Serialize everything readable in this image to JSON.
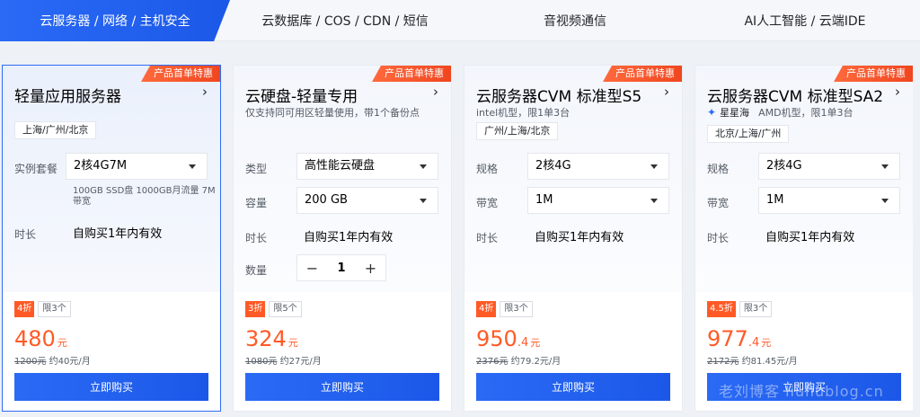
{
  "tabs": [
    {
      "label": "云服务器 / 网络 / 主机安全",
      "active": true
    },
    {
      "label": "云数据库 / COS / CDN / 短信",
      "active": false
    },
    {
      "label": "音视频通信",
      "active": false
    },
    {
      "label": "AI人工智能 / 云端IDE",
      "active": false
    }
  ],
  "colors": {
    "accent": "#1c58e8",
    "price": "#ff5a26",
    "ribbon": "#f0461f"
  },
  "cards": [
    {
      "ribbon": "产品首单特惠",
      "title": "轻量应用服务器",
      "arrow": "›",
      "region": "上海/广州/北京",
      "spec_label": "实例套餐",
      "spec_value": "2核4G7M",
      "spec_note": "100GB SSD盘 1000GB月流量 7M带宽",
      "duration_label": "时长",
      "duration_value": "自购买1年内有效",
      "discount": "4折",
      "limit": "限3个",
      "price_big": "480",
      "price_small": "",
      "price_unit": "元",
      "orig_price": "1200元",
      "monthly": "约40元/月",
      "buy": "立即购买"
    },
    {
      "ribbon": "产品首单特惠",
      "title": "云硬盘-轻量专用",
      "arrow": "›",
      "subtitle": "仅支持同可用区轻量使用，带1个备份点",
      "type_label": "类型",
      "type_value": "高性能云硬盘",
      "capacity_label": "容量",
      "capacity_value": "200 GB",
      "duration_label": "时长",
      "duration_value": "自购买1年内有效",
      "qty_label": "数量",
      "qty_minus": "−",
      "qty_value": "1",
      "qty_plus": "+",
      "discount": "3折",
      "limit": "限5个",
      "price_big": "324",
      "price_small": "",
      "price_unit": "元",
      "orig_price": "1080元",
      "monthly": "约27元/月",
      "buy": "立即购买"
    },
    {
      "ribbon": "产品首单特惠",
      "title": "云服务器CVM 标准型S5",
      "arrow": "›",
      "subtitle": "intel机型，限1单3台",
      "region": "广州/上海/北京",
      "spec_label": "规格",
      "spec_value": "2核4G",
      "bw_label": "带宽",
      "bw_value": "1M",
      "duration_label": "时长",
      "duration_value": "自购买1年内有效",
      "discount": "4折",
      "limit": "限3个",
      "price_big": "950",
      "price_small": ".4",
      "price_unit": "元",
      "orig_price": "2376元",
      "monthly": "约79.2元/月",
      "buy": "立即购买"
    },
    {
      "ribbon": "产品首单特惠",
      "title": "云服务器CVM 标准型SA2",
      "arrow": "›",
      "brand": "星星海",
      "subtitle": "AMD机型，限1单3台",
      "region": "北京/上海/广州",
      "spec_label": "规格",
      "spec_value": "2核4G",
      "bw_label": "带宽",
      "bw_value": "1M",
      "duration_label": "时长",
      "duration_value": "自购买1年内有效",
      "discount": "4.5折",
      "limit": "限3个",
      "price_big": "977",
      "price_small": ".4",
      "price_unit": "元",
      "orig_price": "2172元",
      "monthly": "约81.45元/月",
      "buy": "立即购买"
    }
  ],
  "watermark": "老刘博客 liuliublog.cn"
}
